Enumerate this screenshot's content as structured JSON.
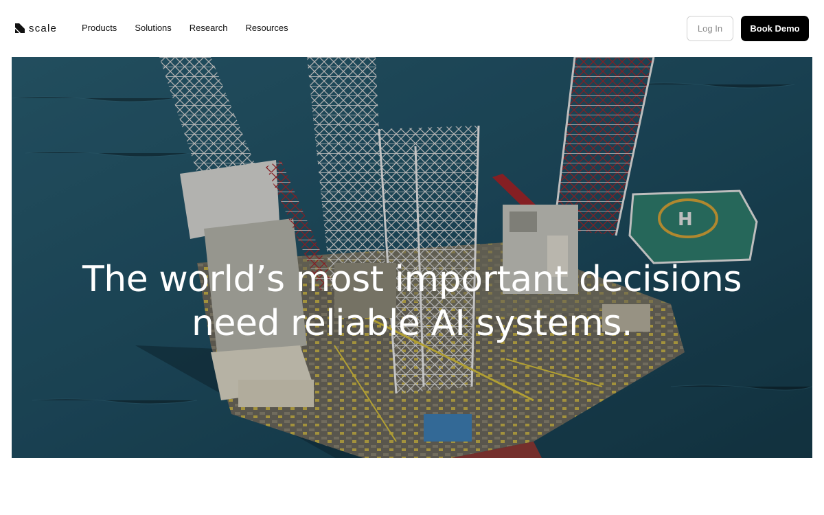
{
  "brand": {
    "name": "scale",
    "icon": "scale-logo-icon"
  },
  "nav": {
    "items": [
      {
        "label": "Products"
      },
      {
        "label": "Solutions"
      },
      {
        "label": "Research"
      },
      {
        "label": "Resources"
      }
    ]
  },
  "auth": {
    "login_label": "Log In",
    "demo_label": "Book Demo"
  },
  "hero": {
    "headline_line1": "The world’s most important decisions",
    "headline_line2": "need reliable AI systems.",
    "image_subject": "offshore-oil-rig-aerial-photo"
  },
  "colors": {
    "primary": "#000000",
    "background": "#ffffff",
    "ocean": "#1d4a5c",
    "rig_red": "#a3262b"
  }
}
